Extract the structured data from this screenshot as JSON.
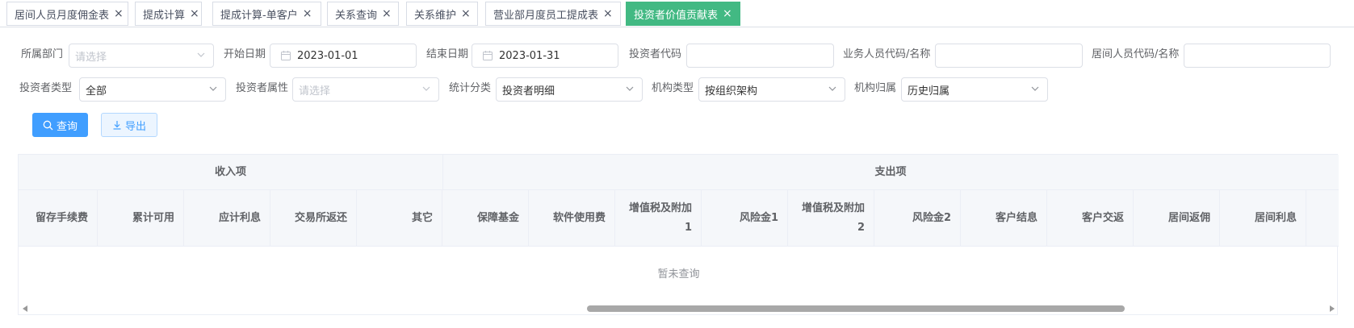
{
  "tabs": [
    {
      "label": "居间人员月度佣金表",
      "close": "×"
    },
    {
      "label": "提成计算",
      "close": "×"
    },
    {
      "label": "提成计算-单客户",
      "close": "×"
    },
    {
      "label": "关系查询",
      "close": "×"
    },
    {
      "label": "关系维护",
      "close": "×"
    },
    {
      "label": "营业部月度员工提成表",
      "close": "×"
    },
    {
      "label": "投资者价值贡献表",
      "close": "×",
      "active": true
    }
  ],
  "filters": {
    "dept": {
      "label": "所属部门",
      "placeholder": "请选择"
    },
    "start_date": {
      "label": "开始日期",
      "value": "2023-01-01"
    },
    "end_date": {
      "label": "结束日期",
      "value": "2023-01-31"
    },
    "investor_code": {
      "label": "投资者代码",
      "value": ""
    },
    "staff_code": {
      "label": "业务人员代码/名称",
      "value": ""
    },
    "broker_code": {
      "label": "居间人员代码/名称",
      "value": ""
    },
    "investor_type": {
      "label": "投资者类型",
      "value": "全部"
    },
    "investor_attr": {
      "label": "投资者属性",
      "placeholder": "请选择"
    },
    "stat_category": {
      "label": "统计分类",
      "value": "投资者明细"
    },
    "org_type": {
      "label": "机构类型",
      "value": "按组织架构"
    },
    "org_owner": {
      "label": "机构归属",
      "value": "历史归属"
    }
  },
  "buttons": {
    "query": "查询",
    "export": "导出"
  },
  "table": {
    "group_income": "收入项",
    "group_expense": "支出项",
    "columns": [
      {
        "label": "留存手续费"
      },
      {
        "label": "累计可用"
      },
      {
        "label": "应计利息"
      },
      {
        "label": "交易所返还"
      },
      {
        "label": "其它"
      },
      {
        "label": "保障基金"
      },
      {
        "label": "软件使用费"
      },
      {
        "label": "增值税及附加1"
      },
      {
        "label": "风险金1"
      },
      {
        "label": "增值税及附加2"
      },
      {
        "label": "风险金2"
      },
      {
        "label": "客户结息"
      },
      {
        "label": "客户交返"
      },
      {
        "label": "居间返佣"
      },
      {
        "label": "居间利息"
      }
    ],
    "empty_text": "暂未查询"
  },
  "colors": {
    "primary": "#409eff",
    "active_tab": "#42b983"
  }
}
